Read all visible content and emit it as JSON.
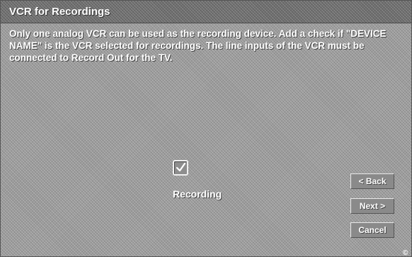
{
  "window": {
    "title": "VCR for Recordings"
  },
  "main": {
    "instructions": "Only one analog VCR can be used as the recording device.  Add a check if \"DEVICE NAME\" is the VCR selected for recordings.  The line inputs of the VCR must be connected to Record Out for the TV.",
    "recording_checkbox": {
      "label": "Recording",
      "checked": true
    }
  },
  "nav": {
    "back_label": "< Back",
    "next_label": "Next >",
    "cancel_label": "Cancel"
  },
  "icons": {
    "checkbox_mark": "checkmark-icon",
    "corner": "copyright-icon"
  },
  "colors": {
    "panel": "#9b9b9b",
    "title_bar": "#6e6e6e",
    "text": "#ffffff"
  }
}
